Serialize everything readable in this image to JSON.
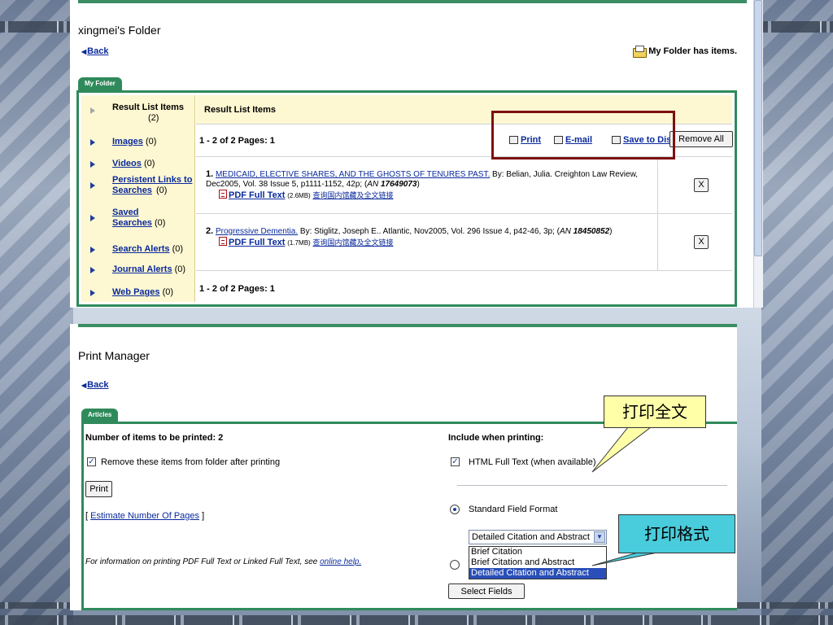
{
  "folder": {
    "title": "xingmei's Folder",
    "back": "Back",
    "status": "My Folder has items.",
    "tab": "My Folder",
    "nav": [
      {
        "label": "Result List Items",
        "count": "(2)",
        "current": true
      },
      {
        "label": "Images",
        "count": "(0)"
      },
      {
        "label": "Videos",
        "count": "(0)"
      },
      {
        "label": "Persistent Links to Searches",
        "count": "(0)"
      },
      {
        "label": "Saved Searches",
        "count": "(0)"
      },
      {
        "label": "Search Alerts",
        "count": "(0)"
      },
      {
        "label": "Journal Alerts",
        "count": "(0)"
      },
      {
        "label": "Web Pages",
        "count": "(0)"
      }
    ],
    "list_header": "Result List Items",
    "pages": "1 - 2 of 2  Pages: 1",
    "actions": {
      "print": "Print",
      "email": "E-mail",
      "save": "Save to Disk"
    },
    "remove_all": "Remove All",
    "records": [
      {
        "num": "1.",
        "title": "MEDICAID, ELECTIVE SHARES, AND THE GHOSTS OF TENURES PAST.",
        "citation": " By: Belian, Julia. Creighton Law Review, Dec2005, Vol. 38 Issue 5, p1111-1152, 42p; (",
        "an_label": "AN",
        "an": "17649073",
        "close": ")",
        "pdf": "PDF Full Text",
        "size": "(2.6MB)",
        "cn": "查询国内馆藏及全文链接",
        "remove": "X"
      },
      {
        "num": "2.",
        "title": "Progressive Dementia.",
        "citation": " By: Stiglitz, Joseph E.. Atlantic, Nov2005, Vol. 296 Issue 4, p42-46, 3p; (",
        "an_label": "AN",
        "an": "18450852",
        "close": ")",
        "pdf": "PDF Full Text",
        "size": "(1.7MB)",
        "cn": "查询国内馆藏及全文链接",
        "remove": "X"
      }
    ],
    "pages_bottom": "1 - 2 of 2  Pages: 1"
  },
  "print_manager": {
    "title": "Print Manager",
    "back": "Back",
    "tab": "Articles",
    "items_label": "Number of items to be printed: 2",
    "remove_label": "Remove these items from folder after printing",
    "print_button": "Print",
    "estimate_prefix": "[ ",
    "estimate_link": "Estimate Number Of Pages",
    "estimate_suffix": " ]",
    "info_text": "For information on printing PDF Full Text or Linked Full Text, see ",
    "info_link": "online help.",
    "include_label": "Include when printing:",
    "html_full_text": "HTML Full Text (when available)",
    "standard_format": "Standard Field Format",
    "format_selected": "Detailed Citation and Abstract",
    "format_options": [
      "Brief Citation",
      "Brief Citation and Abstract",
      "Detailed Citation and Abstract"
    ],
    "select_fields": "Select Fields"
  },
  "callouts": {
    "print_full_text": "打印全文",
    "print_format": "打印格式"
  },
  "colors": {
    "accent_green": "#2f8a5b",
    "link_blue": "#0a2a9c",
    "highlight_red": "#7d1010",
    "callout_yellow": "#ffffa8",
    "callout_cyan": "#49ccdc"
  }
}
